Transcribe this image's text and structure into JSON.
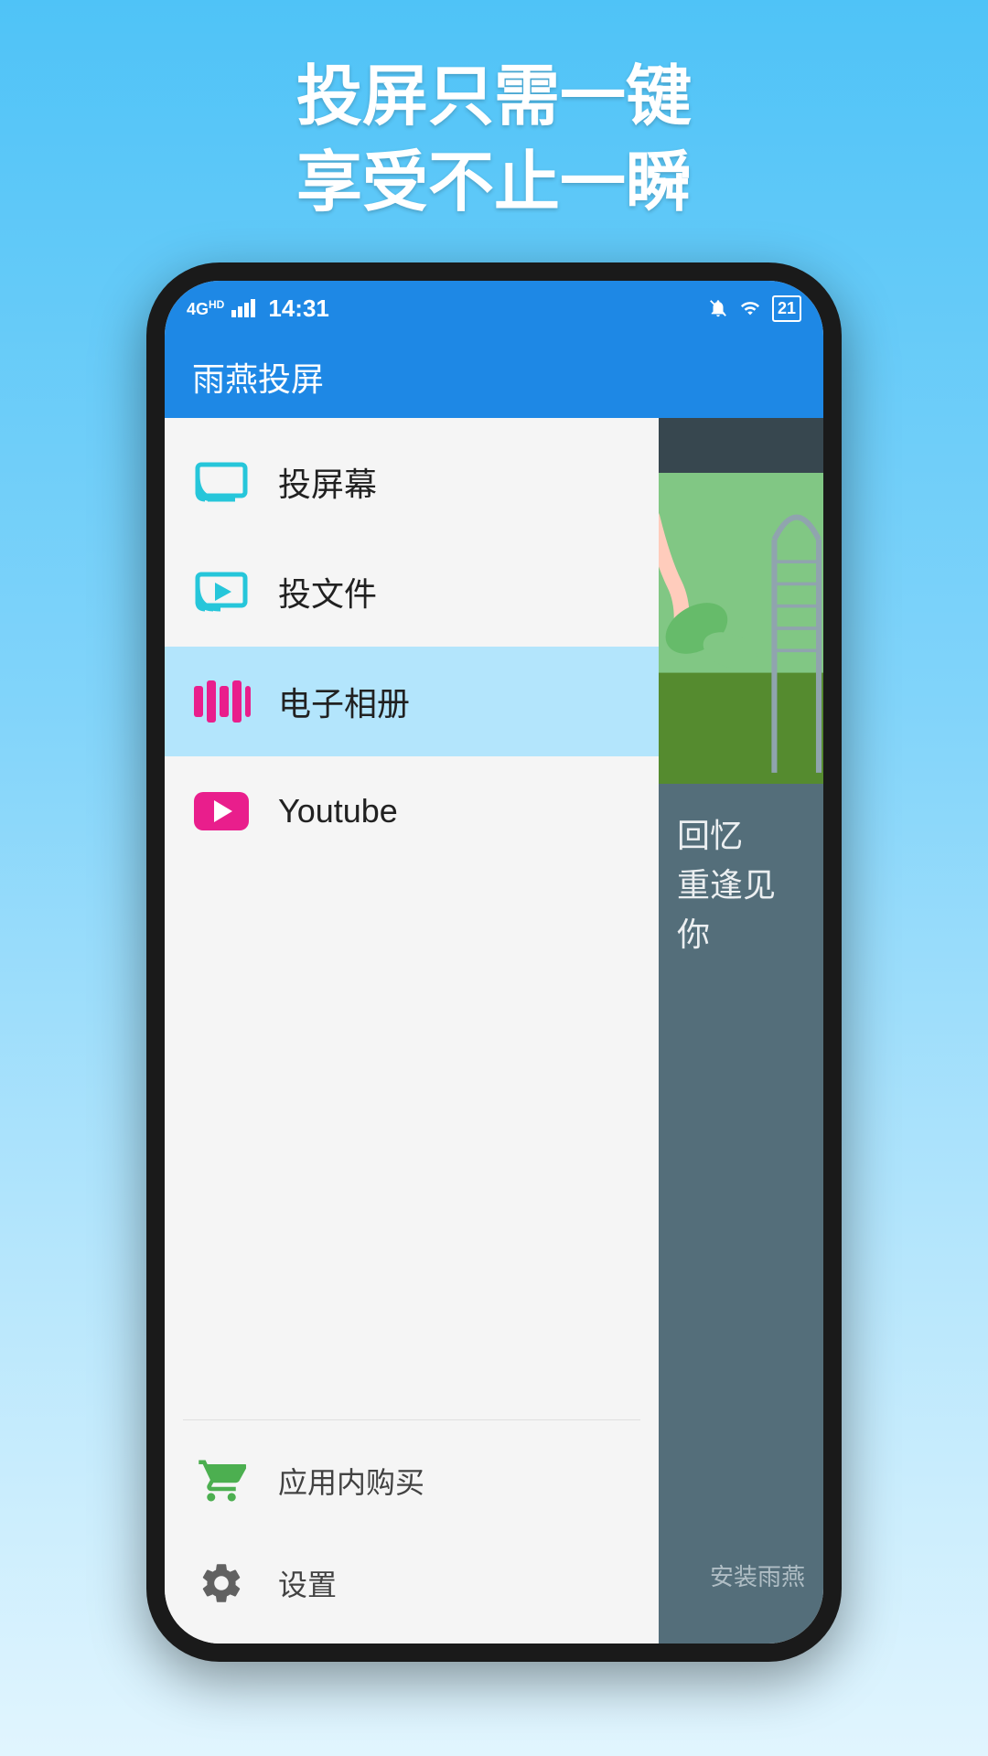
{
  "page": {
    "header_line1": "投屏只需一键",
    "header_line2": "享受不止一瞬"
  },
  "status_bar": {
    "network": "4G",
    "time": "14:31",
    "battery": "21"
  },
  "app_bar": {
    "title": "雨燕投屏"
  },
  "menu": {
    "items": [
      {
        "id": "cast-screen",
        "label": "投屏幕",
        "icon": "cast-screen-icon",
        "active": false
      },
      {
        "id": "cast-file",
        "label": "投文件",
        "icon": "cast-file-icon",
        "active": false
      },
      {
        "id": "photo-album",
        "label": "电子相册",
        "icon": "photo-album-icon",
        "active": true
      },
      {
        "id": "youtube",
        "label": "Youtube",
        "icon": "youtube-icon",
        "active": false
      }
    ],
    "bottom_items": [
      {
        "id": "in-app-purchase",
        "label": "应用内购买",
        "icon": "cart-icon"
      },
      {
        "id": "settings",
        "label": "设置",
        "icon": "settings-icon"
      }
    ]
  },
  "right_panel": {
    "caption_line1": "忆",
    "caption_line2": "见你",
    "install_text": "安装雨燕"
  },
  "colors": {
    "accent_blue": "#1e88e5",
    "accent_cyan": "#26c6da",
    "accent_pink": "#e91e8c",
    "active_bg": "#b3e5fc",
    "green": "#4caf50"
  }
}
